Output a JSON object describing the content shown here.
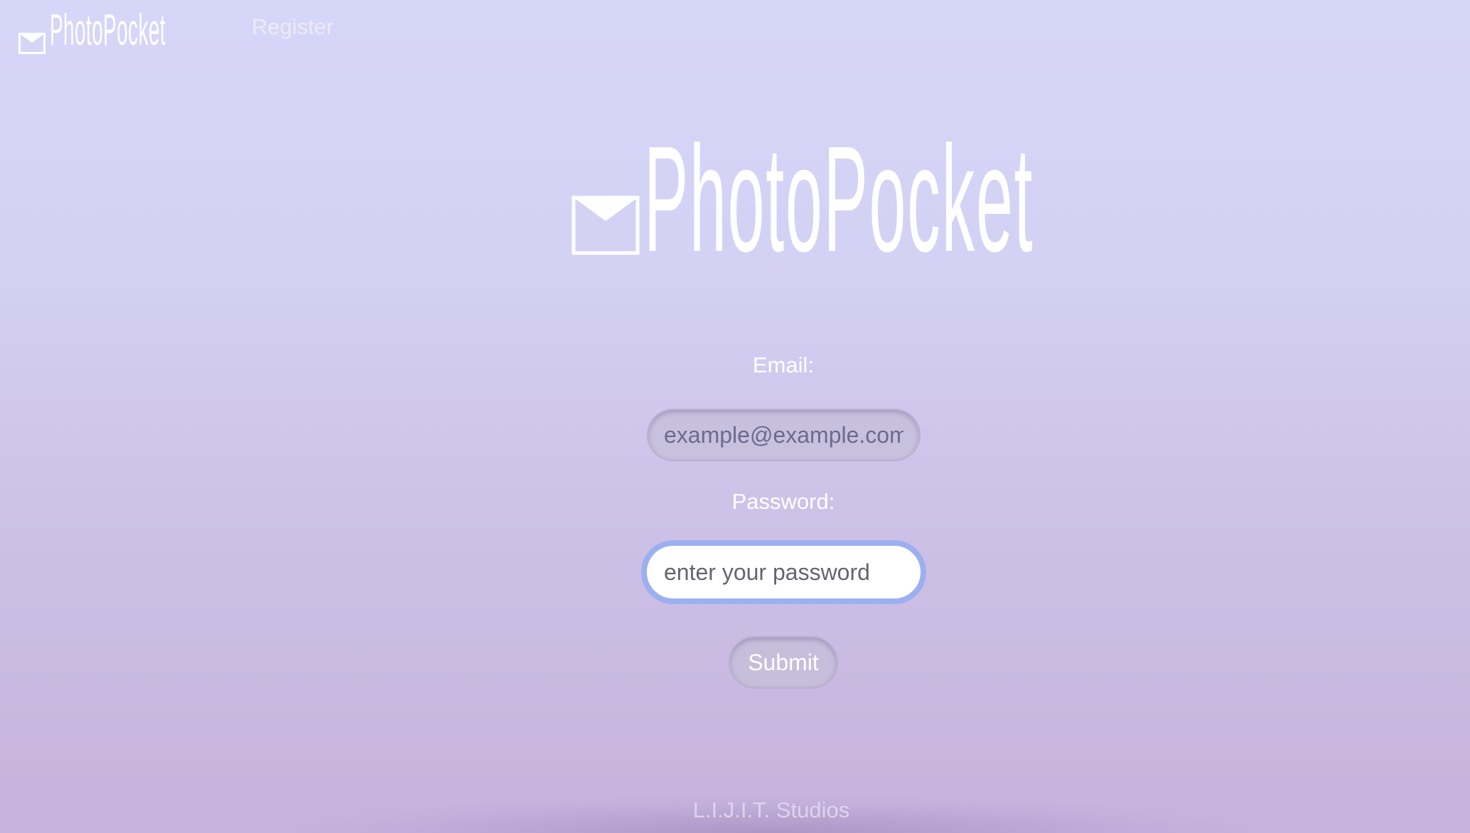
{
  "brand": {
    "name": "PhotoPocket"
  },
  "nav": {
    "register_label": "Register"
  },
  "form": {
    "email_label": "Email:",
    "email_placeholder": "example@example.com",
    "password_label": "Password:",
    "password_placeholder": "enter your password",
    "submit_label": "Submit"
  },
  "footer": {
    "text": "L.I.J.I.T. Studios"
  },
  "colors": {
    "background_top": "#d6d6f8",
    "background_bottom": "#c6b2dc",
    "focus_ring": "#9bb0f0",
    "text": "#ffffff"
  },
  "icons": {
    "logo": "envelope-icon"
  }
}
